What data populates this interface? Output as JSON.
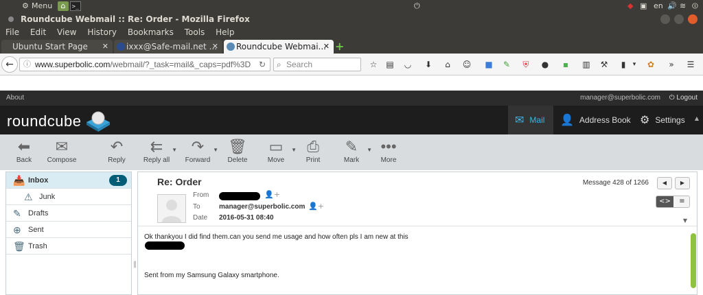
{
  "os_panel": {
    "menu_label": "Menu",
    "lang": "en"
  },
  "window": {
    "title": "Roundcube Webmail :: Re: Order - Mozilla Firefox"
  },
  "menubar": [
    "File",
    "Edit",
    "View",
    "History",
    "Bookmarks",
    "Tools",
    "Help"
  ],
  "tabs": [
    {
      "label": "Ubuntu Start Page",
      "active": false
    },
    {
      "label": "ixxx@Safe-mail.net ...",
      "active": false
    },
    {
      "label": "Roundcube Webmai...",
      "active": true
    }
  ],
  "navbar": {
    "url_host": "www.superbolic.com",
    "url_path": "/webmail/?_task=mail&_caps=pdf%3D",
    "search_placeholder": "Search"
  },
  "rc": {
    "about_label": "About",
    "user_email": "manager@superbolic.com",
    "logout_label": "Logout",
    "logo_text": "roundcube",
    "tasks": {
      "mail": "Mail",
      "addressbook": "Address Book",
      "settings": "Settings"
    },
    "toolbar": {
      "back": "Back",
      "compose": "Compose",
      "reply": "Reply",
      "reply_all": "Reply all",
      "forward": "Forward",
      "delete": "Delete",
      "move": "Move",
      "print": "Print",
      "mark": "Mark",
      "more": "More"
    },
    "folders": [
      {
        "label": "Inbox",
        "unread": "1"
      },
      {
        "label": "Junk"
      },
      {
        "label": "Drafts"
      },
      {
        "label": "Sent"
      },
      {
        "label": "Trash"
      }
    ],
    "message": {
      "subject": "Re: Order",
      "counter": "Message 428 of 1266",
      "from_label": "From",
      "to_label": "To",
      "date_label": "Date",
      "to_value": "manager@superbolic.com",
      "date_value": "2016-05-31 08:40",
      "body_line1": "Ok thankyou I did find them.can you send me usage and how often pls I am new at this",
      "body_line2": "Sent from my Samsung Galaxy smartphone."
    }
  }
}
